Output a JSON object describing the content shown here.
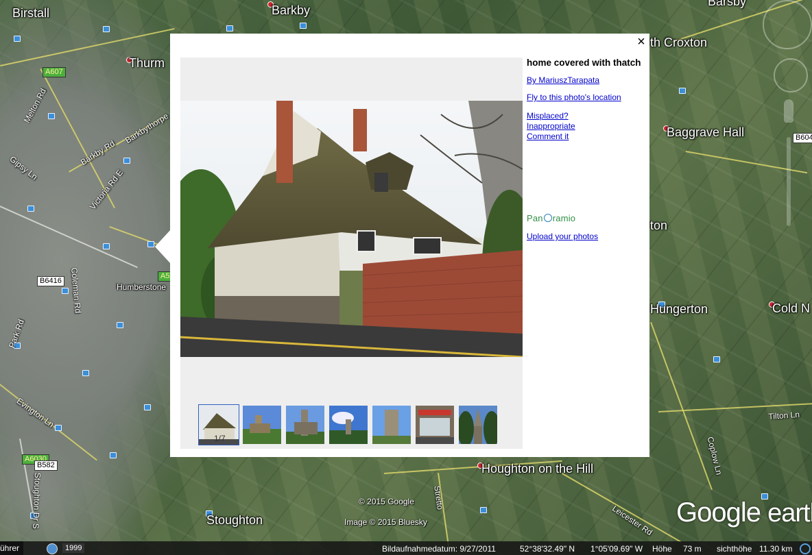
{
  "map": {
    "places": {
      "birstall": "Birstall",
      "barkby": "Barkby",
      "thurmaston": "Thurm",
      "south_croxton": "th Croxton",
      "baggrave_hall": "Baggrave Hall",
      "humberstone": "Humberstone",
      "hungerton": "Hungerton",
      "cold_newton": "Cold N",
      "houghton": "Houghton on the Hill",
      "stoughton": "Stoughton",
      "keyham_fragment": "ton",
      "barsby_fragment": "Barsby"
    },
    "roads": {
      "a607": "A607",
      "b6416": "B6416",
      "a6030": "A6030",
      "b582": "B582",
      "a5_fragment": "A5",
      "b604": "B604",
      "melton_rd": "Melton Rd",
      "barkby_rd": "Barkby Rd",
      "barkbythorpe": "Barkbythorpe",
      "gipsy_ln": "Gipsy Ln",
      "victoria_rd": "Victoria Rd E",
      "coleman_rd": "Coleman Rd",
      "park_rd": "Park Rd",
      "evington_ln": "Evington Ln",
      "stoughton_dr": "Stoughton Dr S",
      "stretton": "Stretto",
      "leicester_rd": "Leicester Rd",
      "coplow_ln": "Coplow Ln",
      "tilton_ln": "Tilton Ln"
    },
    "copyright_1": "© 2015 Google",
    "copyright_2": "Image © 2015 Bluesky",
    "logo_google": "Google",
    "logo_earth": "earth"
  },
  "status": {
    "tour_guide": "ührer",
    "year": "1999",
    "imagery_date": "Bildaufnahmedatum: 9/27/2011",
    "lat": "52°38'32.49\" N",
    "lon": "1°05'09.69\" W",
    "elev_label": "Höhe",
    "elev_value": "73 m",
    "eye_label": "sichthöhe",
    "eye_value": "11.30 km"
  },
  "balloon": {
    "close_icon": "×",
    "title": "home covered with thatch",
    "author_link": "By MariuszTarapata",
    "fly_link": "Fly to this photo's location",
    "misplaced_link": "Misplaced?",
    "inappropriate_link": "Inappropriate",
    "comment_link": "Comment it",
    "panoramio_pre": "Pan",
    "panoramio_post": "ramio",
    "upload_link": "Upload your photos",
    "thumb_counter": "1/7",
    "thumbnails": [
      "thatched-house",
      "church-field",
      "church-tower",
      "church-sky",
      "stone-tower",
      "shop-front",
      "church-trees"
    ]
  }
}
